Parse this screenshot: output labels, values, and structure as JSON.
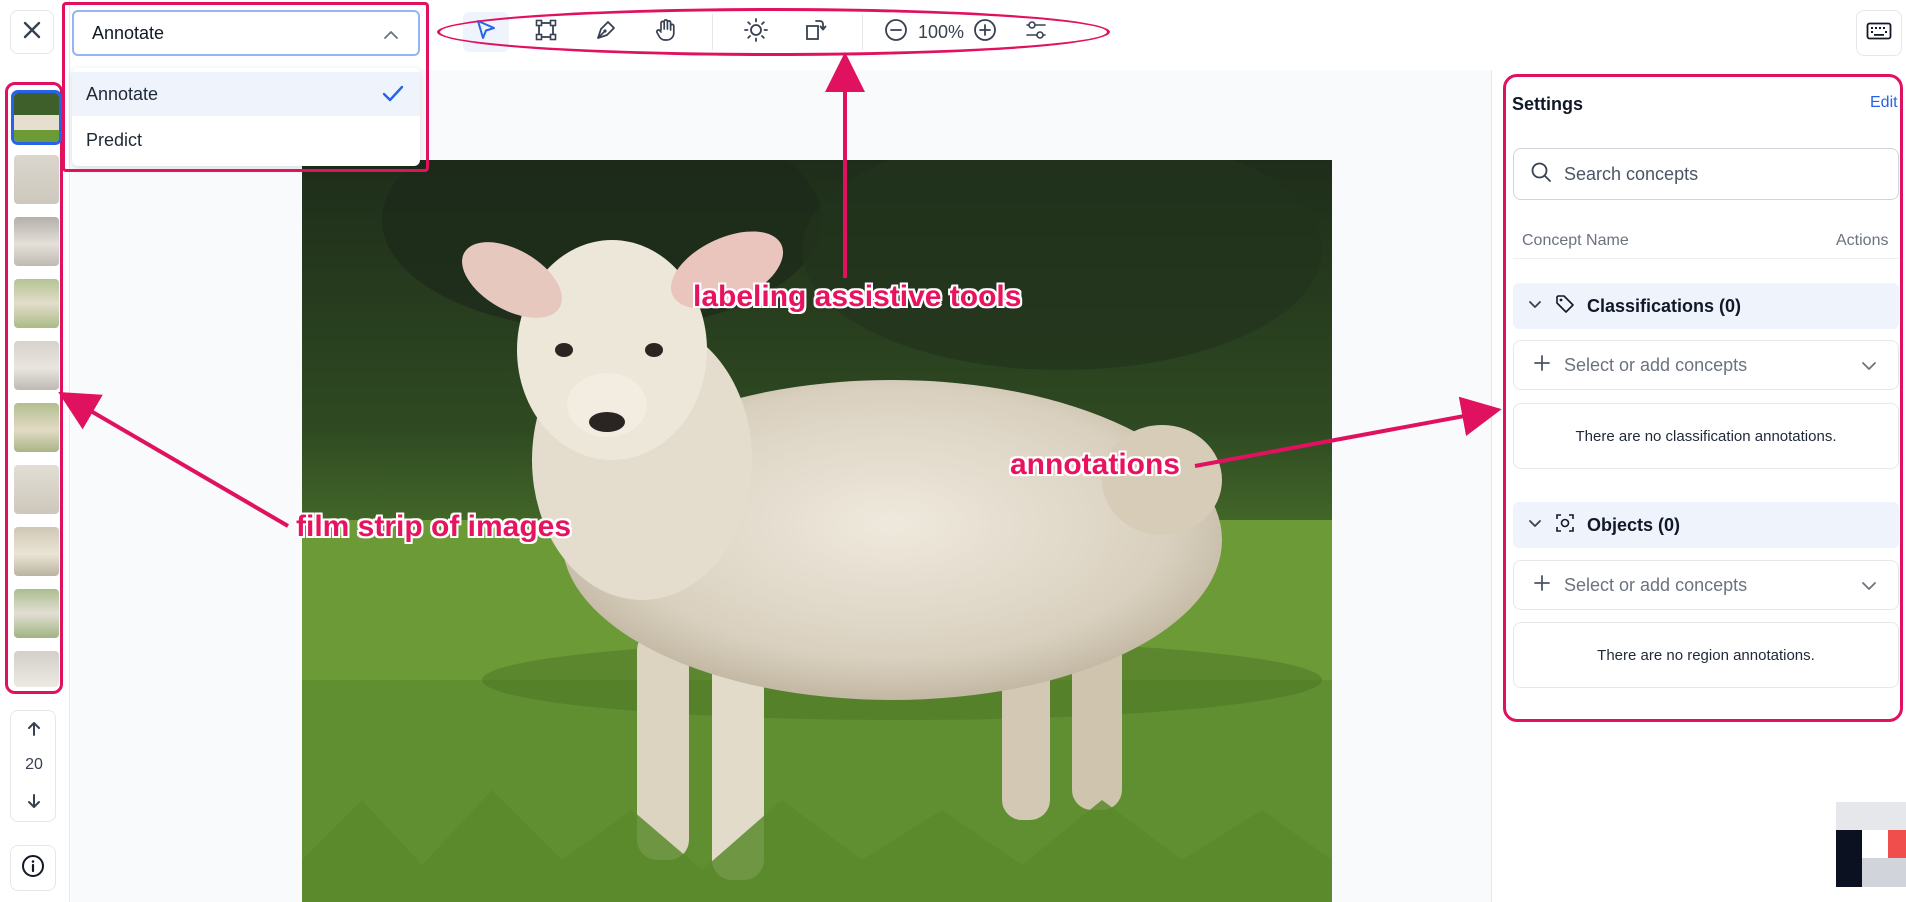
{
  "mode": {
    "selected": "Annotate",
    "options": [
      "Annotate",
      "Predict"
    ]
  },
  "toolbar": {
    "zoom": "100%",
    "tools": [
      "select-tool",
      "bounding-box-tool",
      "polygon-tool",
      "pan-tool",
      "brightness-tool",
      "rotate-tool",
      "zoom-out",
      "zoom-in",
      "adjustments"
    ]
  },
  "pager": {
    "count": "20"
  },
  "settings": {
    "title": "Settings",
    "edit_label": "Edit",
    "search_placeholder": "Search concepts",
    "col_concept": "Concept Name",
    "col_actions": "Actions",
    "classifications": {
      "header": "Classifications (0)",
      "select_label": "Select or add concepts",
      "empty": "There are no classification annotations."
    },
    "objects": {
      "header": "Objects (0)",
      "select_label": "Select or add concepts",
      "empty": "There are no region annotations."
    }
  },
  "annotations": {
    "tools_label": "labeling assistive tools",
    "film_label": "film strip of images",
    "panel_label": "annotations"
  },
  "colors": {
    "accent": "#e0115f",
    "primary": "#2563eb"
  }
}
